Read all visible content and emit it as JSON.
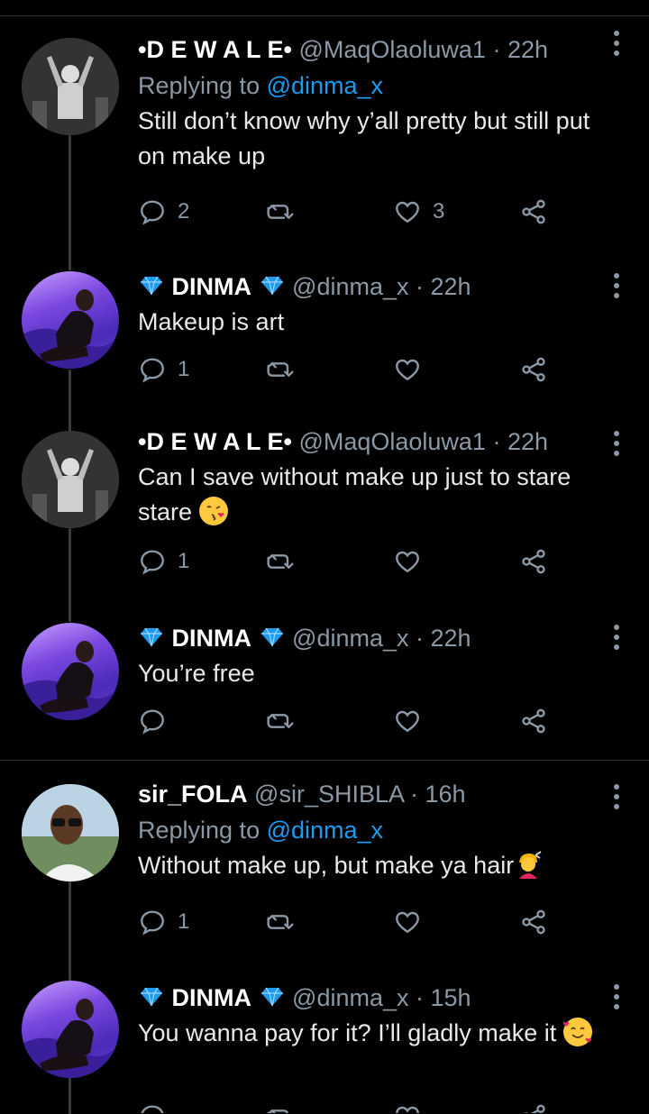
{
  "tweets": [
    {
      "name": "•D E W A L E•",
      "handle": "@MaqOlaoluwa1",
      "time": "· 22h",
      "replying_prefix": "Replying to ",
      "replying_to": "@dinma_x",
      "text": "Still don’t know why y’all pretty but still put on make up",
      "replies": "2",
      "likes": "3"
    },
    {
      "name": "DINMA",
      "handle": "@dinma_x",
      "time": "· 22h",
      "text": "Makeup is art",
      "replies": "1"
    },
    {
      "name": "•D E W A L E•",
      "handle": "@MaqOlaoluwa1",
      "time": "· 22h",
      "text": "Can I save without make up just to stare stare",
      "replies": "1"
    },
    {
      "name": "DINMA",
      "handle": "@dinma_x",
      "time": "· 22h",
      "text": "You’re free"
    },
    {
      "name": "sir_FOLA",
      "handle": "@sir_SHIBLA",
      "time": "· 16h",
      "replying_prefix": "Replying to ",
      "replying_to": "@dinma_x",
      "text": "Without make up, but make ya hair",
      "replies": "1"
    },
    {
      "name": "DINMA",
      "handle": "@dinma_x",
      "time": "· 15h",
      "text": "You wanna pay for it? I’ll gladly make it"
    }
  ],
  "icons": {
    "reply": "reply-icon",
    "retweet": "retweet-icon",
    "like": "heart-icon",
    "share": "share-icon",
    "more": "more-options-icon",
    "verified_gem": "gem-icon"
  },
  "colors": {
    "background": "#000000",
    "secondary_text": "#8b98a5",
    "mention": "#1d9bf0",
    "gem": "#1d9bf0"
  }
}
